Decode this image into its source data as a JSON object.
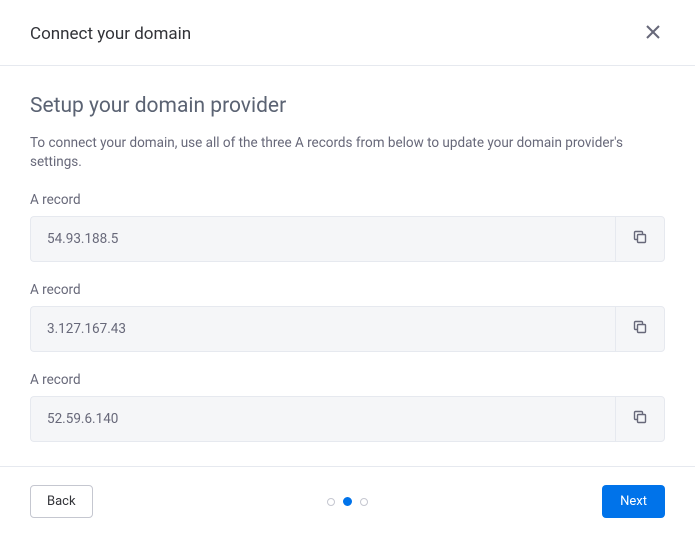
{
  "dialog": {
    "title": "Connect your domain"
  },
  "main": {
    "heading": "Setup your domain provider",
    "description": "To connect your domain, use all of the three A records from below to update your domain provider's settings."
  },
  "records": [
    {
      "label": "A record",
      "value": "54.93.188.5"
    },
    {
      "label": "A record",
      "value": "3.127.167.43"
    },
    {
      "label": "A record",
      "value": "52.59.6.140"
    }
  ],
  "footer": {
    "back_label": "Back",
    "next_label": "Next",
    "active_step": 1,
    "total_steps": 3
  }
}
